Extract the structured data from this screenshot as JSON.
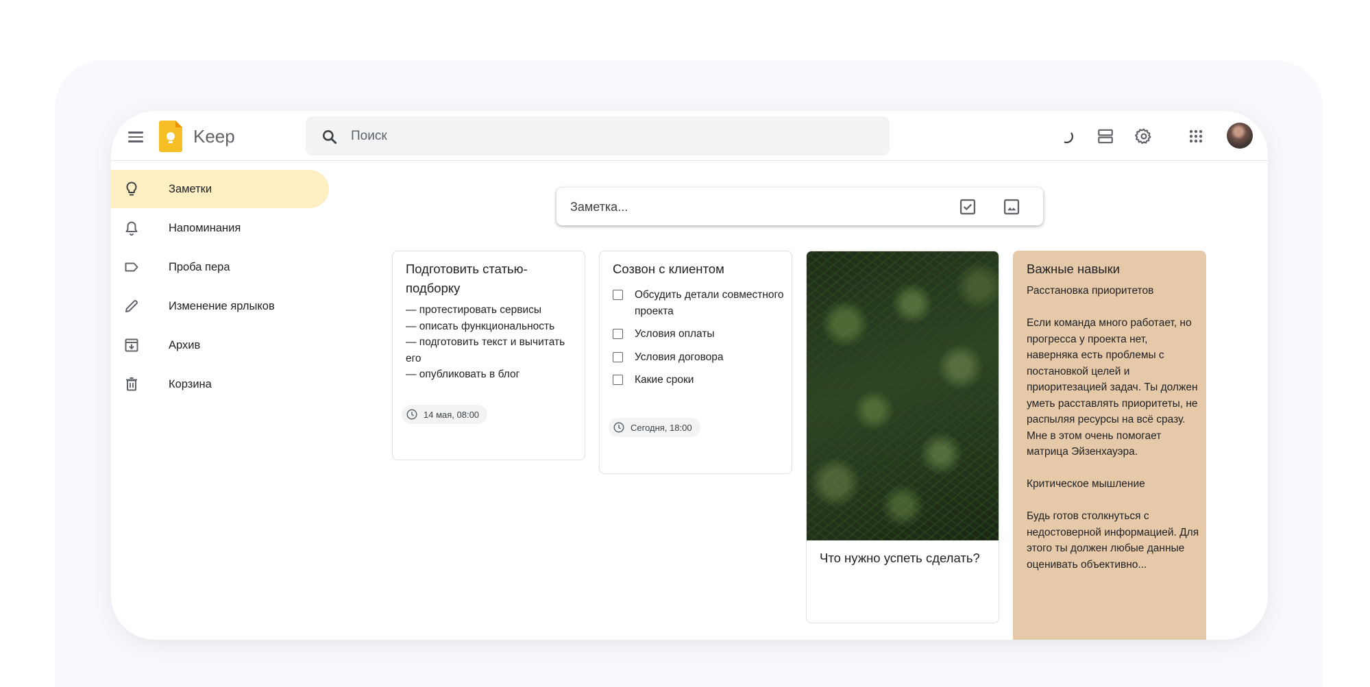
{
  "app": {
    "name": "Keep"
  },
  "search": {
    "placeholder": "Поиск"
  },
  "sidebar": {
    "items": [
      {
        "label": "Заметки",
        "icon": "lightbulb-icon",
        "active": true
      },
      {
        "label": "Напоминания",
        "icon": "bell-icon"
      },
      {
        "label": "Проба пера",
        "icon": "label-icon"
      },
      {
        "label": "Изменение ярлыков",
        "icon": "pencil-icon"
      },
      {
        "label": "Архив",
        "icon": "archive-icon"
      },
      {
        "label": "Корзина",
        "icon": "trash-icon"
      }
    ]
  },
  "take_note": {
    "placeholder": "Заметка..."
  },
  "notes": [
    {
      "title": "Подготовить статью-подборку",
      "body": "— протестировать сервисы\n— описать функциональность\n— подготовить текст и вычитать его\n— опубликовать в блог",
      "reminder": "14 мая, 08:00"
    },
    {
      "title": "Созвон с клиентом",
      "items": [
        "Обсудить детали совместного проекта",
        "Условия оплаты",
        "Условия договора",
        "Какие сроки"
      ],
      "reminder": "Сегодня, 18:00"
    },
    {
      "title": "Что нужно успеть сделать?",
      "image": "pine-branches-photo"
    },
    {
      "title": "Важные навыки",
      "body": "Расстановка приоритетов\n\nЕсли команда много работает, но прогресса у проекта нет, наверняка есть проблемы с постановкой целей и приоритезацией задач. Ты должен уметь расставлять приоритеты, не распыляя ресурсы на всё сразу. Мне в этом очень помогает матрица Эйзенхауэра.\n\nКритическое мышление\n\nБудь готов столкнуться с недостоверной информацией. Для этого ты должен любые данные оценивать объективно...",
      "color": "#e6c9a8"
    }
  ],
  "colors": {
    "active_nav": "#feefc3",
    "note_tan": "#e6c9a8",
    "logo_yellow": "#f6bf26"
  }
}
